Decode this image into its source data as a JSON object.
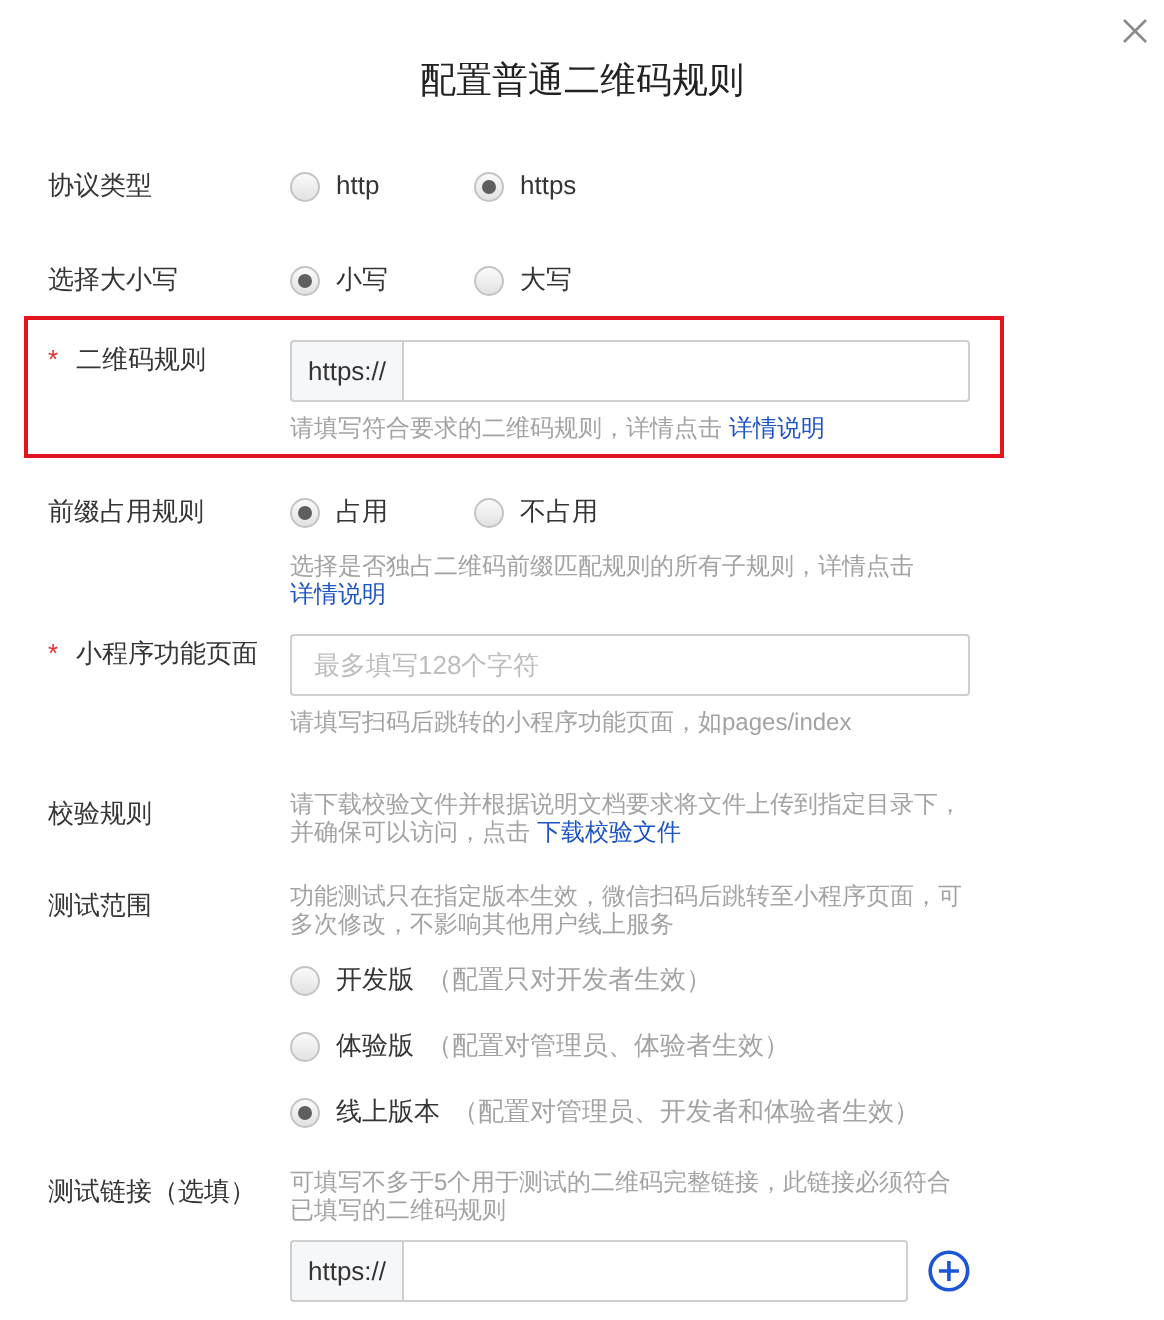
{
  "dialog": {
    "title": "配置普通二维码规则"
  },
  "rows": [
    {
      "kind": "radio",
      "label": "协议类型",
      "highlighted": false,
      "options": [
        {
          "label": "http",
          "selected": false
        },
        {
          "label": "https",
          "selected": true
        }
      ]
    },
    {
      "kind": "radio",
      "label": "选择大小写",
      "highlighted": false,
      "options": [
        {
          "label": "小写",
          "selected": true
        },
        {
          "label": "大写",
          "selected": false
        }
      ]
    },
    {
      "kind": "input",
      "label": "二维码规则",
      "required_mark": "*",
      "highlighted": true,
      "prefix": "https://",
      "hint": {
        "text": "请填写符合要求的二维码规则，详情点击 ",
        "link": "详情说明"
      }
    },
    {
      "kind": "radio",
      "label": "前缀占用规则",
      "highlighted": false,
      "options": [
        {
          "label": "占用",
          "selected": true
        },
        {
          "label": "不占用",
          "selected": false
        }
      ],
      "hint": {
        "text": "选择是否独占二维码前缀匹配规则的所有子规则，详情点击",
        "link": "详情说明"
      }
    },
    {
      "kind": "input",
      "label": "小程序功能页面",
      "required_mark": "*",
      "highlighted": false,
      "placeholder": "最多填写128个字符",
      "hint": {
        "text": "请填写扫码后跳转的小程序功能页面，如pages/index"
      }
    },
    {
      "kind": "note",
      "label": "校验规则",
      "highlighted": false,
      "hint": {
        "text": "请下载校验文件并根据说明文档要求将文件上传到指定目录下，并确保可以访问，点击 ",
        "link": "下载校验文件"
      }
    },
    {
      "kind": "scope",
      "label": "测试范围",
      "highlighted": false,
      "hint": {
        "text": "功能测试只在指定版本生效，微信扫码后跳转至小程序页面，可多次修改，不影响其他用户线上服务"
      },
      "options": [
        {
          "label": "开发版",
          "note": "（配置只对开发者生效）",
          "selected": false
        },
        {
          "label": "体验版",
          "note": "（配置对管理员、体验者生效）",
          "selected": false
        },
        {
          "label": "线上版本",
          "note": "（配置对管理员、开发者和体验者生效）",
          "selected": true
        }
      ]
    },
    {
      "kind": "links",
      "label": "测试链接（选填）",
      "highlighted": false,
      "prefix": "https://",
      "hint": {
        "text": "可填写不多于5个用于测试的二维码完整链接，此链接必须符合已填写的二维码规则"
      }
    }
  ]
}
